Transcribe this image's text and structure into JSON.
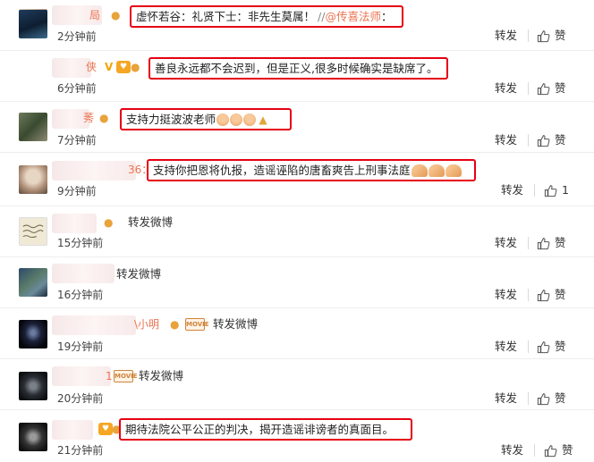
{
  "comments": [
    {
      "name_tail": "局",
      "text": "虚怀若谷：礼贤下士：非先生莫属！",
      "extra": "// ",
      "mention": "@传喜法师",
      "colon": "：",
      "time": "2分钟前",
      "repost": "转发",
      "like": "赞",
      "avatar_colors": [
        "#d9c7b5",
        "#8a6c56"
      ]
    },
    {
      "name_tail": "侠",
      "text": "善良永远都不会迟到，但是正义,很多时候确实是缺席了。",
      "time": "6分钟前",
      "repost": "转发",
      "like": "赞",
      "avatar_colors": [
        "#1f3b5c",
        "#3c6b8c"
      ]
    },
    {
      "name_tail": "莠",
      "text": "支持力挺波波老师",
      "time": "7分钟前",
      "repost": "转发",
      "like": "赞",
      "avatar_colors": [
        "#4a5a40",
        "#8c8a72"
      ]
    },
    {
      "name_tail": "36：",
      "text": "支持你把恩将仇报，造谣诬陷的唐畜爽告上刑事法庭",
      "time": "9分钟前",
      "repost": "转发",
      "like": "1",
      "avatar_colors": [
        "#c9b8a8",
        "#5a4a3c"
      ]
    },
    {
      "name_tail": "",
      "text": "转发微博",
      "time": "15分钟前",
      "repost": "转发",
      "like": "赞",
      "avatar_colors": [
        "#e8e2d0",
        "#b8a880"
      ]
    },
    {
      "name_tail": "",
      "text": "转发微博",
      "time": "16分钟前",
      "repost": "转发",
      "like": "赞",
      "avatar_colors": [
        "#2c4a6a",
        "#6a8a9a"
      ]
    },
    {
      "name_tail": "\\小明",
      "text": "转发微博",
      "time": "19分钟前",
      "repost": "转发",
      "like": "赞",
      "avatar_colors": [
        "#0a0a12",
        "#3a4a6a"
      ]
    },
    {
      "name_tail": "1",
      "text": "转发微博",
      "time": "20分钟前",
      "repost": "转发",
      "like": "赞",
      "avatar_colors": [
        "#15181c",
        "#7a8088"
      ]
    },
    {
      "name_tail": "",
      "text": "期待法院公平公正的判决，揭开造谣诽谤者的真面目。",
      "time": "21分钟前",
      "repost": "转发",
      "like": "赞",
      "avatar_colors": [
        "#1a1a1a",
        "#777777"
      ]
    }
  ],
  "badges": {
    "v": "V",
    "heart": "♥",
    "movie": "MOVIE"
  },
  "icons": {
    "like": "thumbs-up-icon",
    "bulb": "lightbulb-icon",
    "pray": "pray-emoji"
  }
}
